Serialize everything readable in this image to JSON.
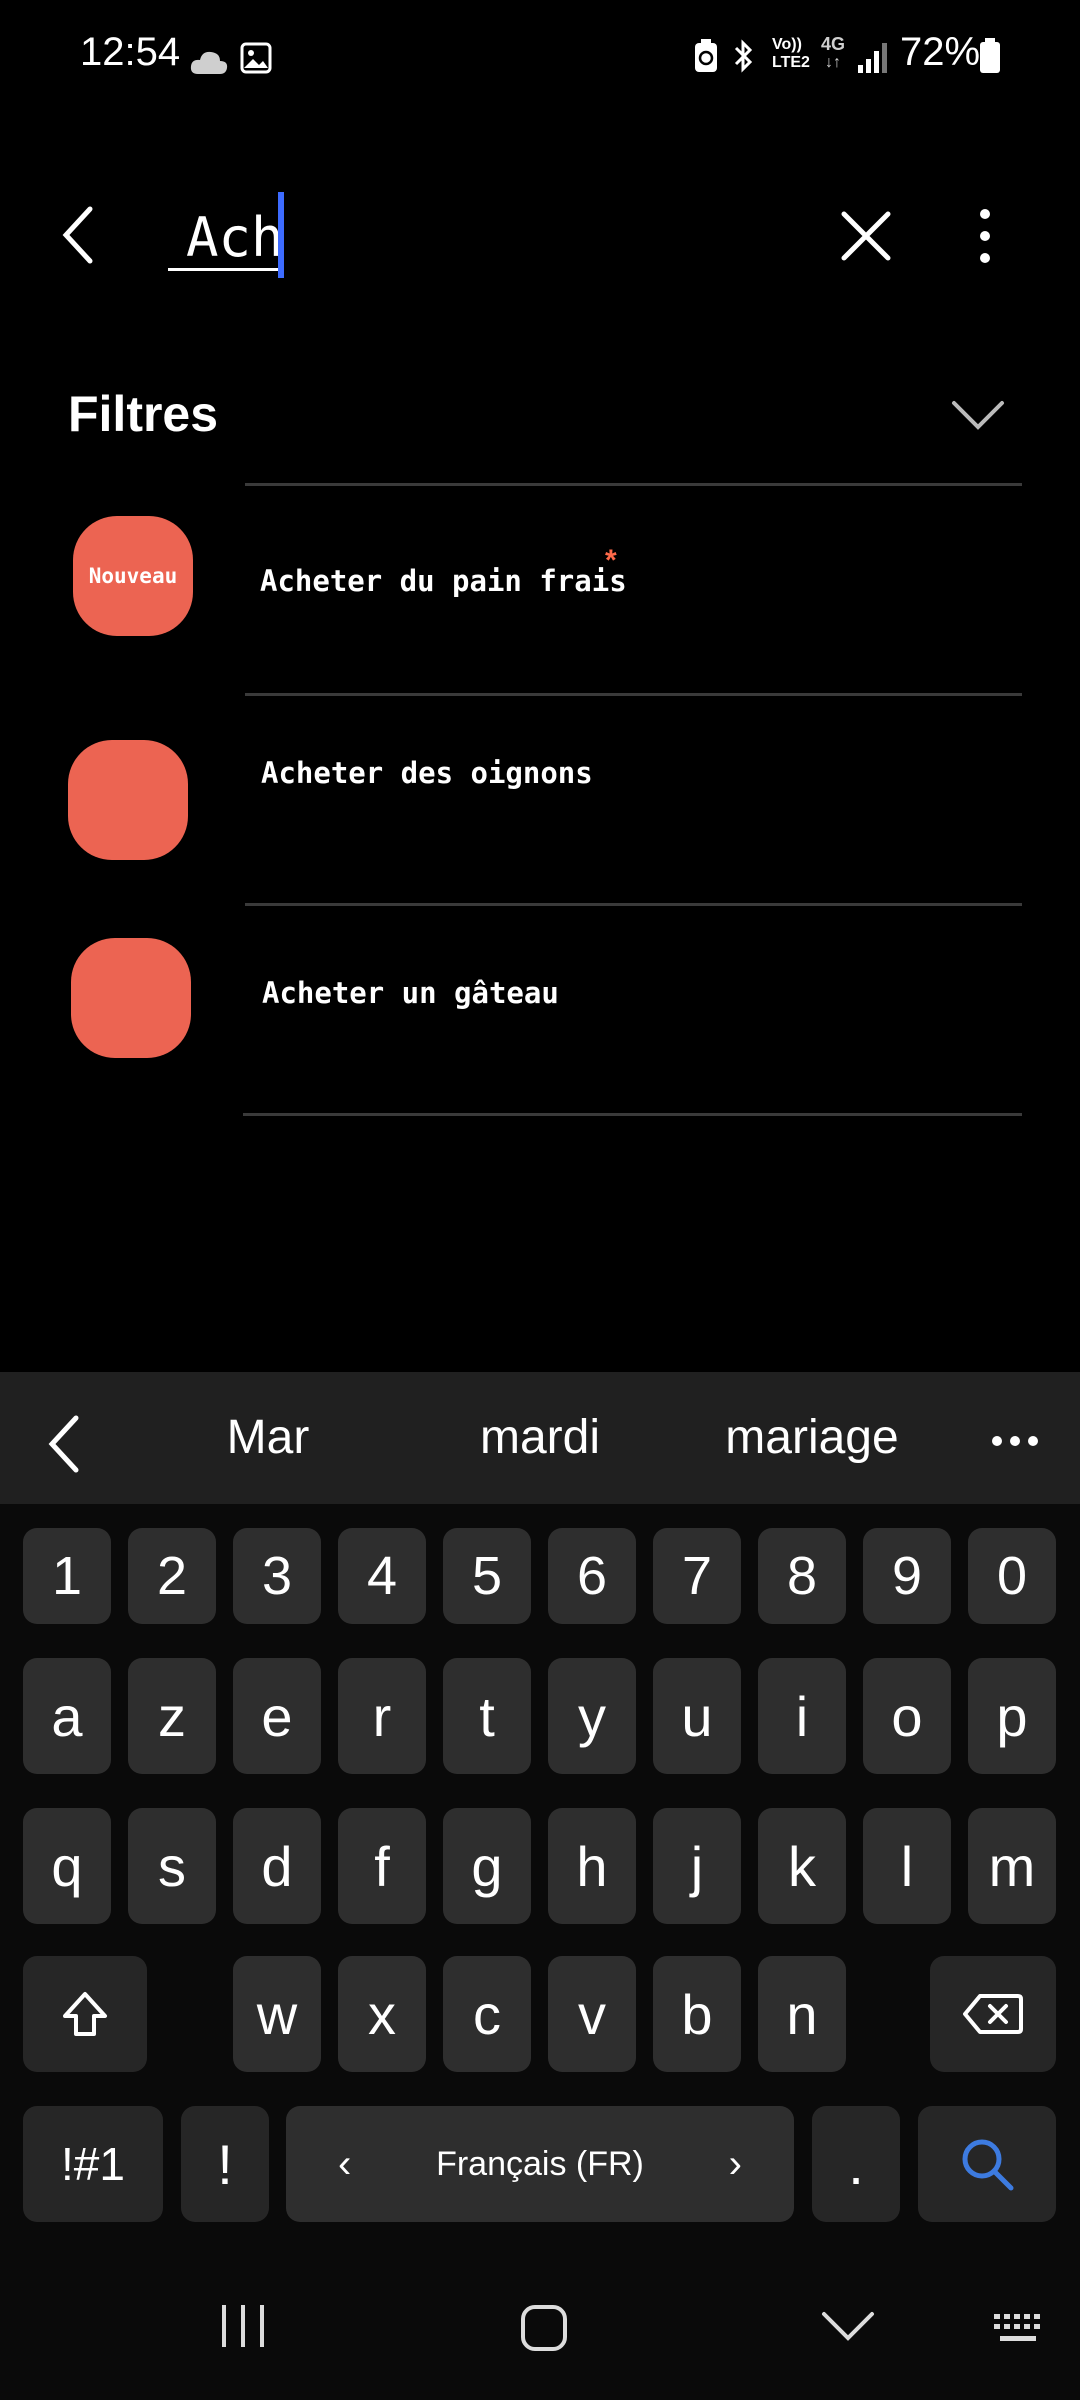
{
  "status_bar": {
    "time": "12:54",
    "network_label_top": "Vo))",
    "network_label_bottom": "LTE2",
    "network_type": "4G",
    "battery_percent": "72%",
    "icons": [
      "cloud-icon",
      "gallery-icon",
      "battery-saver-icon",
      "bluetooth-icon",
      "volte-icon",
      "data-4g-icon",
      "signal-icon",
      "battery-icon"
    ]
  },
  "search": {
    "value": "Ach",
    "placeholder": ""
  },
  "filters": {
    "title": "Filtres"
  },
  "tasks": [
    {
      "label": "Acheter du pain frais",
      "badge": "Nouveau",
      "new_marker": "*"
    },
    {
      "label": "Acheter des oignons"
    },
    {
      "label": "Acheter un gâteau"
    }
  ],
  "keyboard": {
    "suggestions": [
      "Mar",
      "mardi",
      "mariage"
    ],
    "row_numbers": [
      "1",
      "2",
      "3",
      "4",
      "5",
      "6",
      "7",
      "8",
      "9",
      "0"
    ],
    "row_1": [
      "a",
      "z",
      "e",
      "r",
      "t",
      "y",
      "u",
      "i",
      "o",
      "p"
    ],
    "row_2": [
      "q",
      "s",
      "d",
      "f",
      "g",
      "h",
      "j",
      "k",
      "l",
      "m"
    ],
    "row_3": [
      "w",
      "x",
      "c",
      "v",
      "b",
      "n"
    ],
    "symbols_key": "!#1",
    "exclamation_key": "!",
    "language": "Français (FR)",
    "period_key": ".",
    "accent_color": "#3d7be0"
  },
  "colors": {
    "task_blob": "#ec6452",
    "caret": "#3d6bff",
    "new_star": "#ff6a4a"
  }
}
